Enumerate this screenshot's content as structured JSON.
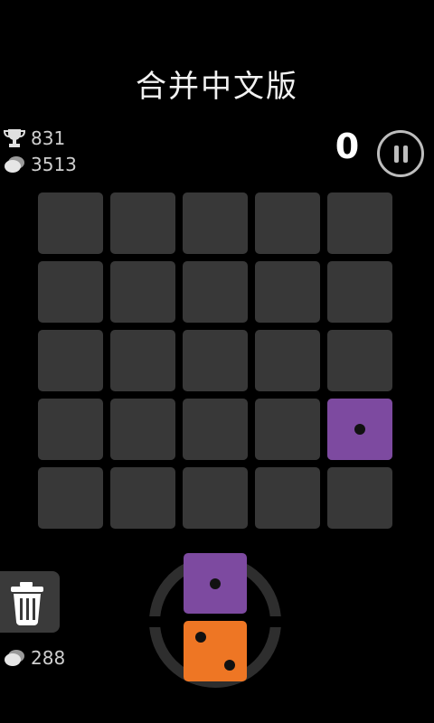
{
  "header": {
    "title": "合并中文版"
  },
  "stats": {
    "best_score": "831",
    "coins": "3513",
    "bottom_coins": "288"
  },
  "game": {
    "score": "0",
    "grid_rows": 5,
    "grid_cols": 5,
    "placed_tiles": [
      {
        "row": 4,
        "col": 5,
        "value": 1,
        "color": "#7d4aa0"
      }
    ],
    "next_pieces": [
      {
        "value": 1,
        "color": "#7d4aa0"
      },
      {
        "value": 2,
        "color": "#ee7624"
      }
    ]
  },
  "icons": {
    "best": "trophy-icon",
    "coins": "coin-stack-icon",
    "pause": "pause-icon",
    "trash": "trash-icon"
  },
  "colors": {
    "background": "#000000",
    "cell": "#383838",
    "purple": "#7d4aa0",
    "orange": "#ee7624"
  }
}
